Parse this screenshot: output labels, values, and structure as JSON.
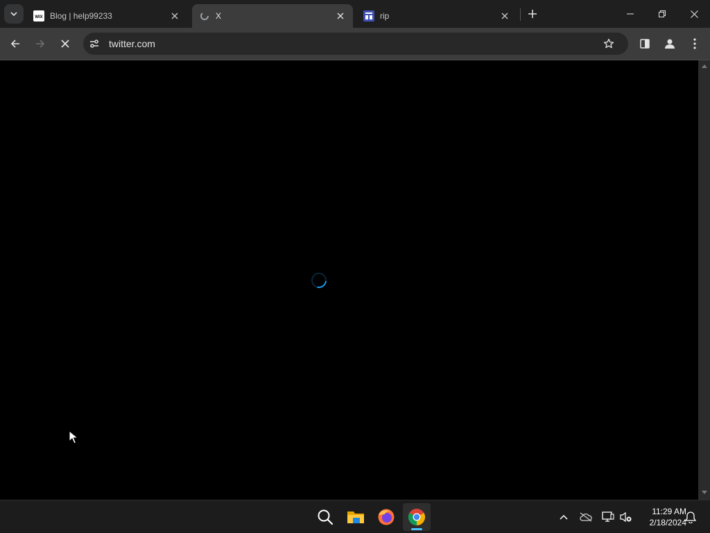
{
  "browser": {
    "tabs": [
      {
        "title": "Blog | help99233",
        "favicon": "wix-icon",
        "active": false
      },
      {
        "title": "X",
        "favicon": "loading-icon",
        "active": true
      },
      {
        "title": "rip",
        "favicon": "site-icon",
        "active": false
      }
    ],
    "address_bar": {
      "url": "twitter.com"
    },
    "loading": true
  },
  "page": {
    "state": "loading",
    "spinner_color": "#1d9bf0"
  },
  "taskbar": {
    "apps": [
      "search-icon",
      "file-explorer-icon",
      "firefox-icon",
      "chrome-icon"
    ],
    "active_app": "chrome-icon",
    "clock": {
      "time": "11:29 AM",
      "date": "2/18/2024"
    }
  },
  "colors": {
    "tab_strip": "#1f1f1f",
    "toolbar": "#3c3c3c",
    "omnibox": "#282828",
    "page_bg": "#000000",
    "taskbar": "#1c1c1c",
    "accent": "#4cc2ff"
  }
}
